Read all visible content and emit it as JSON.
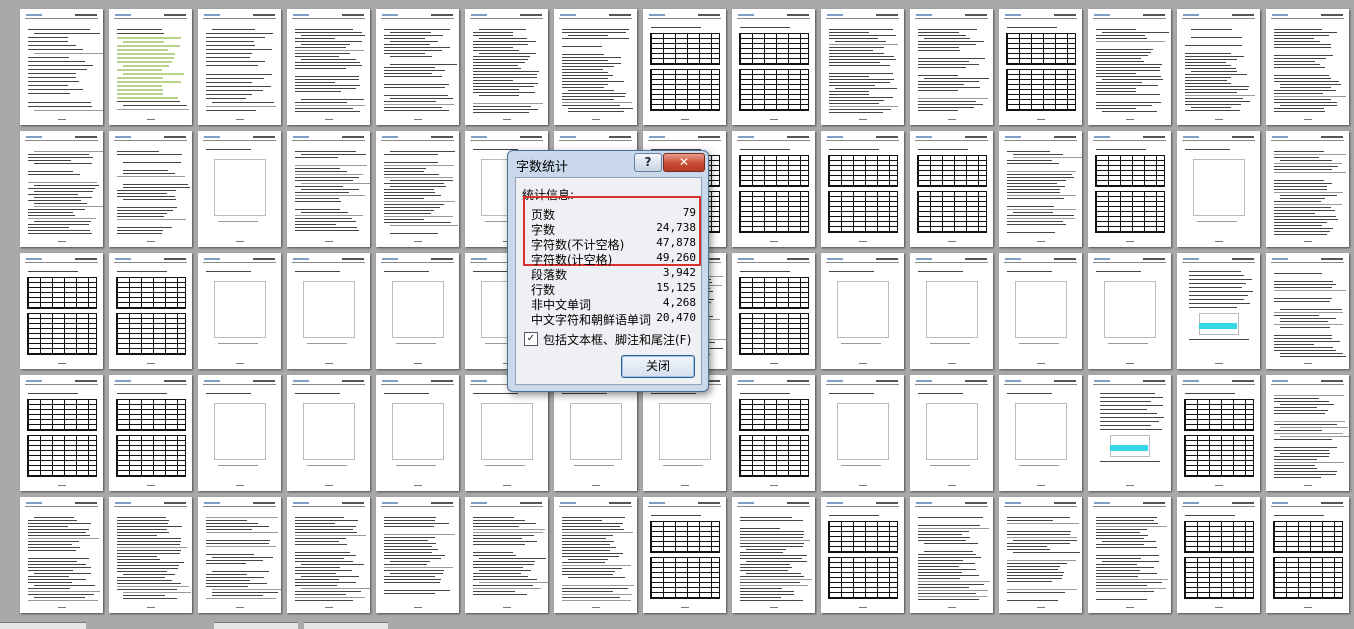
{
  "dialog": {
    "title": "字数统计",
    "help_label": "?",
    "close_x_label": "✕",
    "stats_label": "统计信息:",
    "stats": [
      {
        "label": "页数",
        "value": "79"
      },
      {
        "label": "字数",
        "value": "24,738"
      },
      {
        "label": "字符数(不计空格)",
        "value": "47,878"
      },
      {
        "label": "字符数(计空格)",
        "value": "49,260"
      },
      {
        "label": "段落数",
        "value": "3,942"
      },
      {
        "label": "行数",
        "value": "15,125"
      },
      {
        "label": "非中文单词",
        "value": "4,268"
      },
      {
        "label": "中文字符和朝鲜语单词",
        "value": "20,470"
      }
    ],
    "include_checkbox": {
      "label": "包括文本框、脚注和尾注(F)",
      "checked": true,
      "mark": "✓"
    },
    "close_button_label": "关闭",
    "highlight_color": "#d9312c"
  },
  "thumbnail_grid": {
    "rows": 5,
    "columns": 15,
    "thumbnail_type": "document-page-thumbnail"
  }
}
